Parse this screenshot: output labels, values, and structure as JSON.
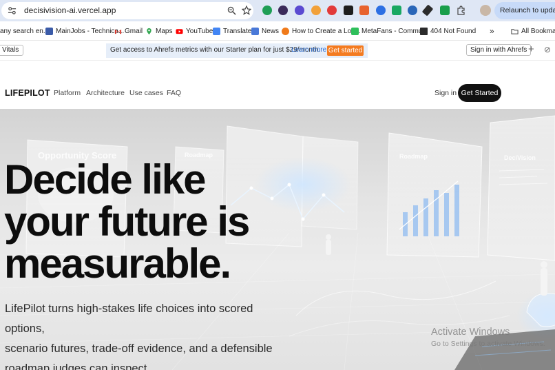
{
  "browser": {
    "url": "decisivision-ai.vercel.app",
    "relaunch_label": "Relaunch to update",
    "bookmarks": [
      {
        "label": "any search en...",
        "icon": "bookmark-icon"
      },
      {
        "label": "MainJobs - Technica...",
        "icon": "mainjobs-icon"
      },
      {
        "label": "Gmail",
        "icon": "gmail-icon"
      },
      {
        "label": "Maps",
        "icon": "maps-icon"
      },
      {
        "label": "YouTube",
        "icon": "youtube-icon"
      },
      {
        "label": "Translate",
        "icon": "translate-icon"
      },
      {
        "label": "News",
        "icon": "news-icon"
      },
      {
        "label": "How to Create a Loc...",
        "icon": "howto-icon"
      },
      {
        "label": "MetaFans - Commu...",
        "icon": "metafans-icon"
      },
      {
        "label": "404 Not Found",
        "icon": "notfound-icon"
      }
    ],
    "more_label": "»",
    "all_bookmarks_label": "All Bookmarks",
    "ahrefs": {
      "vitals_label": "Vitals",
      "promo_text": "Get access to Ahrefs metrics with our Starter plan for just $29/month.",
      "learn_more": "Learn more",
      "get_started": "Get started",
      "sign_in": "Sign in with Ahrefs"
    }
  },
  "site": {
    "logo": "LIFEPILOT",
    "nav": [
      "Platform",
      "Architecture",
      "Use cases",
      "FAQ"
    ],
    "sign_in": "Sign in",
    "cta": "Get Started"
  },
  "hero": {
    "headline": [
      "Decide like",
      "your future is",
      "measurable."
    ],
    "subhead": [
      "LifePilot turns high-stakes life choices into scored options,",
      "scenario futures, trade-off evidence, and a defensible",
      "roadmap judges can inspect."
    ],
    "panel_labels": [
      "Opportunity Score",
      "Roadmap",
      "Roadmap",
      "DeciVision"
    ]
  },
  "watermark": {
    "title": "Activate Windows",
    "subtitle": "Go to Settings to activate Windows."
  },
  "colors": {
    "chrome": "#dfe7f5",
    "accent_orange": "#f47b20",
    "cta_black": "#111111"
  }
}
